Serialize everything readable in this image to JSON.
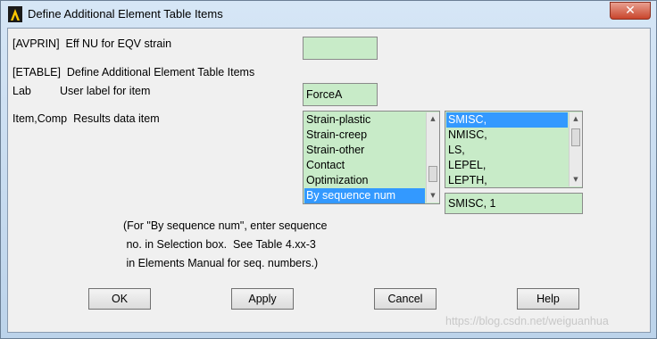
{
  "window": {
    "title": "Define Additional Element Table Items",
    "close_glyph": "✕"
  },
  "avprin": {
    "label": "[AVPRIN]  Eff NU for EQV strain",
    "value": ""
  },
  "etable": {
    "label": "[ETABLE]  Define Additional Element Table Items"
  },
  "lab": {
    "key": "Lab",
    "desc": "User label for item",
    "value": "ForceA"
  },
  "item_comp": {
    "label": "Item,Comp  Results data item",
    "item_list": [
      "Strain-plastic",
      "Strain-creep",
      "Strain-other",
      "Contact",
      "Optimization",
      "By sequence num"
    ],
    "item_selected": "By sequence num",
    "comp_list": [
      "SMISC,",
      "NMISC,",
      "LS,",
      "LEPEL,",
      "LEPTH,"
    ],
    "comp_selected": "SMISC,",
    "selection_value": "SMISC, 1"
  },
  "note": {
    "line1": "(For \"By sequence num\", enter sequence",
    "line2": " no. in Selection box.  See Table 4.xx-3",
    "line3": " in Elements Manual for seq. numbers.)"
  },
  "buttons": {
    "ok": "OK",
    "apply": "Apply",
    "cancel": "Cancel",
    "help": "Help"
  },
  "watermark": "https://blog.csdn.net/weiguanhua",
  "colors": {
    "field_bg": "#c8ebc8",
    "selection": "#3399ff",
    "close_button": "#c9452c"
  }
}
